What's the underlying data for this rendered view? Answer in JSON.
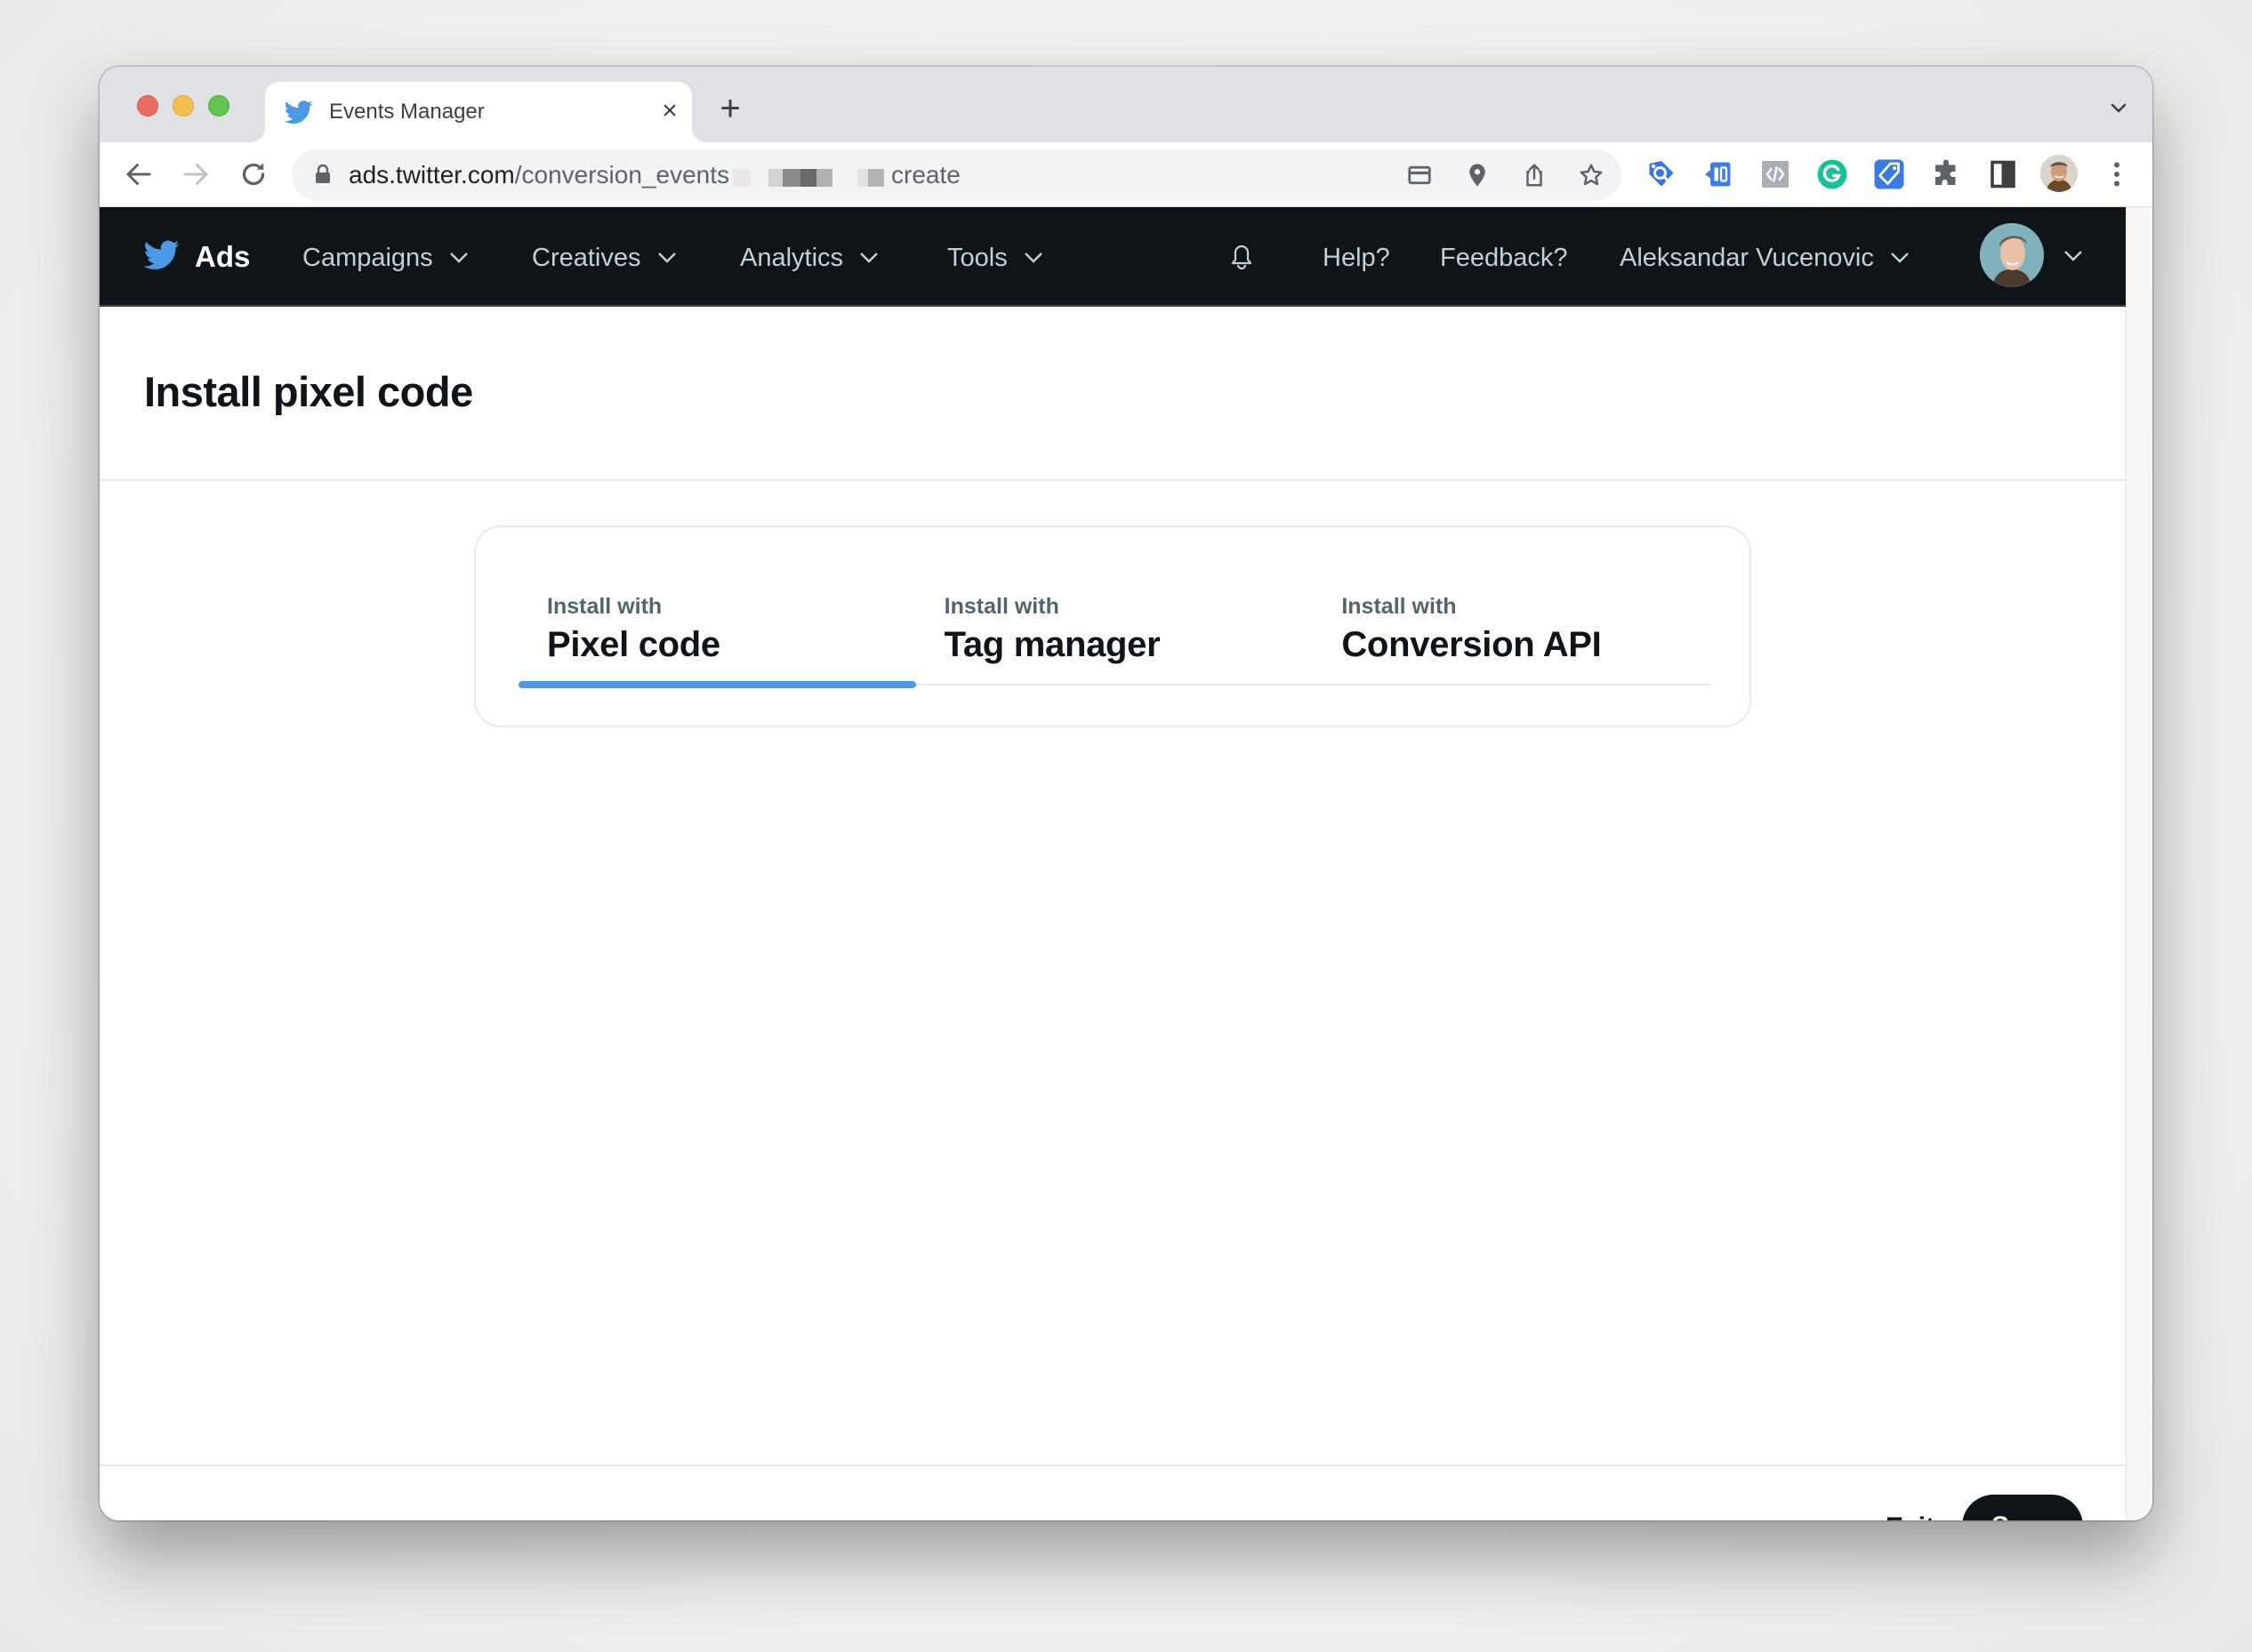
{
  "browser": {
    "tab_title": "Events Manager",
    "tab_favicon": "twitter-bird-icon",
    "url_host": "ads.twitter.com",
    "url_path": "/conversion_events",
    "url_tail": "create",
    "url_redacted": true,
    "toolbar_icons": [
      "back-icon",
      "forward-icon",
      "reload-icon"
    ],
    "omnibox_icons": [
      "card-icon",
      "location-pin-icon",
      "share-icon",
      "bookmark-star-icon"
    ],
    "extension_icons": [
      "tag-assistant-icon",
      "extension-blue-icon",
      "code-viewer-icon",
      "grammarly-icon",
      "tag-extension-icon",
      "puzzle-extensions-icon",
      "side-panel-icon",
      "profile-avatar-icon",
      "more-menu-icon"
    ]
  },
  "nav": {
    "brand": "Ads",
    "items": [
      {
        "label": "Campaigns"
      },
      {
        "label": "Creatives"
      },
      {
        "label": "Analytics"
      },
      {
        "label": "Tools"
      }
    ],
    "help": "Help?",
    "feedback": "Feedback?",
    "user_name": "Aleksandar Vucenovic"
  },
  "page": {
    "title": "Install pixel code"
  },
  "install_tabs": {
    "active_index": 0,
    "items": [
      {
        "kicker": "Install with",
        "label": "Pixel code"
      },
      {
        "kicker": "Install with",
        "label": "Tag manager"
      },
      {
        "kicker": "Install with",
        "label": "Conversion API"
      }
    ]
  },
  "footer": {
    "exit_label": "Exit",
    "save_label": "Save"
  },
  "colors": {
    "nav_bg": "#0f1419",
    "twitter_blue": "#4c9ae6",
    "text_primary": "#0f1419",
    "text_secondary": "#536471",
    "nav_text": "#c4cfd6"
  }
}
